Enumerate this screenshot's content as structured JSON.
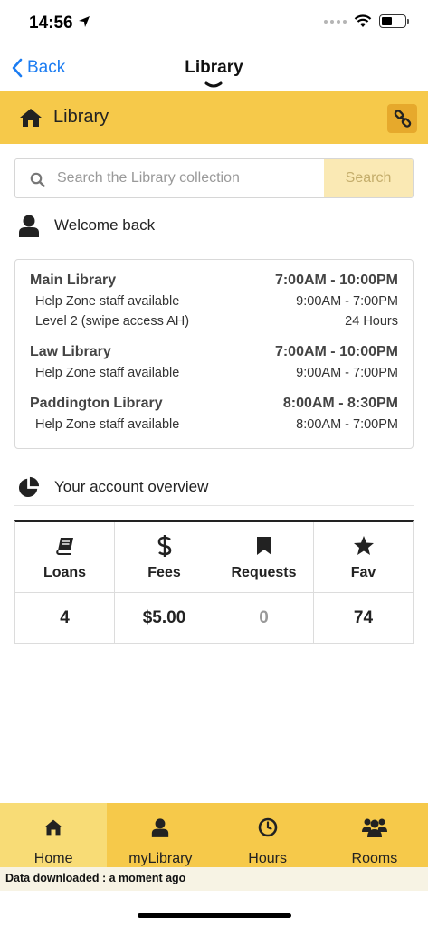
{
  "status_bar": {
    "time": "14:56"
  },
  "nav": {
    "back_label": "Back",
    "title": "Library"
  },
  "header": {
    "title": "Library"
  },
  "search": {
    "placeholder": "Search the Library collection",
    "button_label": "Search"
  },
  "welcome": {
    "text": "Welcome back"
  },
  "hours": [
    {
      "name": "Main Library",
      "time": "7:00AM - 10:00PM",
      "details": [
        {
          "label": "Help Zone staff available",
          "time": "9:00AM - 7:00PM"
        },
        {
          "label": "Level 2 (swipe access AH)",
          "time": "24 Hours"
        }
      ]
    },
    {
      "name": "Law Library",
      "time": "7:00AM - 10:00PM",
      "details": [
        {
          "label": "Help Zone staff available",
          "time": "9:00AM - 7:00PM"
        }
      ]
    },
    {
      "name": "Paddington Library",
      "time": "8:00AM - 8:30PM",
      "details": [
        {
          "label": "Help Zone staff available",
          "time": "8:00AM - 7:00PM"
        }
      ]
    }
  ],
  "account": {
    "heading": "Your account overview",
    "columns": [
      {
        "icon": "book-icon",
        "label": "Loans",
        "value": "4"
      },
      {
        "icon": "dollar-icon",
        "label": "Fees",
        "value": "$5.00"
      },
      {
        "icon": "bookmark-icon",
        "label": "Requests",
        "value": "0"
      },
      {
        "icon": "star-icon",
        "label": "Fav",
        "value": "74"
      }
    ]
  },
  "tabs": [
    {
      "icon": "home-icon",
      "label": "Home"
    },
    {
      "icon": "user-icon",
      "label": "myLibrary"
    },
    {
      "icon": "clock-icon",
      "label": "Hours"
    },
    {
      "icon": "users-icon",
      "label": "Rooms"
    }
  ],
  "footer": {
    "download_text": "Data downloaded : a moment ago"
  },
  "colors": {
    "accent": "#f6c94a",
    "link": "#1b7cf2",
    "active_tab": "#f8dc76"
  }
}
